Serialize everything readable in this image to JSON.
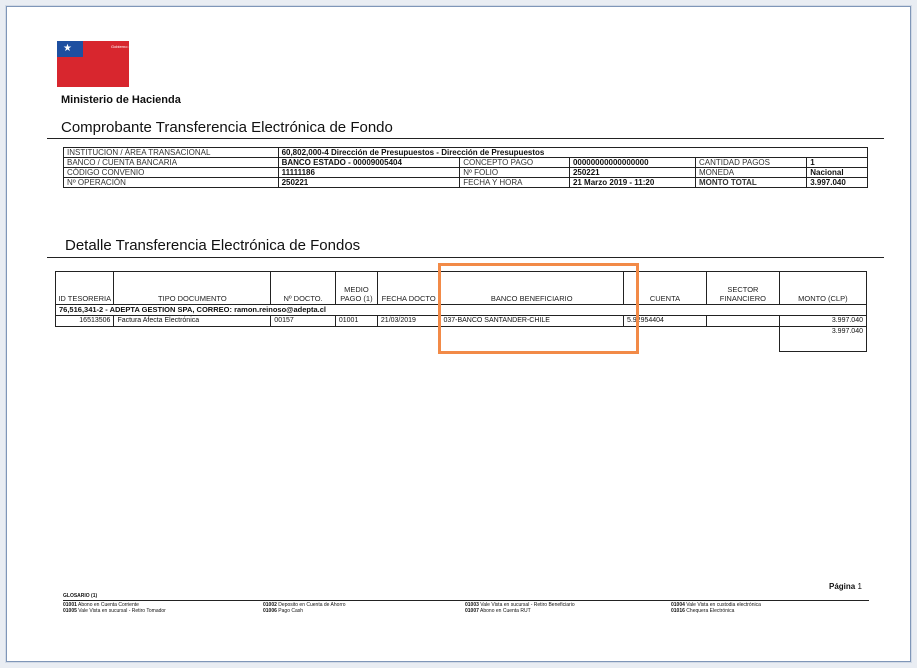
{
  "header": {
    "ministry": "Ministerio de Hacienda",
    "logo_text": "Gobierno de Chile",
    "title": "Comprobante Transferencia Electrónica de Fondo"
  },
  "info": {
    "institucion_label": "INSTITUCION / ÁREA TRANSACIONAL",
    "institucion_value": "60,802,000-4 Dirección de Presupuestos - Dirección de Presupuestos",
    "banco_label": "BANCO / CUENTA BANCARIA",
    "banco_value": "BANCO ESTADO - 00009005404",
    "concepto_label": "CONCEPTO PAGO",
    "concepto_value": "00000000000000000",
    "cantidad_label": "CANTIDAD PAGOS",
    "cantidad_value": "1",
    "codigo_label": "CÓDIGO CONVENIO",
    "codigo_value": "11111186",
    "folio_label": "Nº FOLIO",
    "folio_value": "250221",
    "moneda_label": "MONEDA",
    "moneda_value": "Nacional",
    "operacion_label": "Nº OPERACIÓN",
    "operacion_value": "250221",
    "fecha_label": "FECHA Y HORA",
    "fecha_value": "21 Marzo 2019 - 11:20",
    "monto_label": "MONTO TOTAL",
    "monto_value": "3.997.040"
  },
  "detail": {
    "title": "Detalle Transferencia Electrónica de Fondos",
    "headers": [
      "ID TESORERIA",
      "TIPO DOCUMENTO",
      "Nº DOCTO.",
      "MEDIO PAGO (1)",
      "FECHA DOCTO",
      "BANCO BENEFICIARIO",
      "CUENTA",
      "SECTOR FINANCIERO",
      "MONTO (CLP)"
    ],
    "group_label": "76,516,341-2 - ADEPTA GESTION SPA, CORREO:",
    "group_email": "ramon.reinoso@adepta.cl",
    "row": {
      "id": "16513506",
      "tipo": "Factura Afecta Electrónica",
      "docto": "00157",
      "medio": "01001",
      "fecha": "21/03/2019",
      "banco": "037-BANCO SANTANDER-CHILE",
      "cuenta": "5.92954404",
      "sector": "",
      "monto": "3.997.040"
    },
    "total": "3.997.040"
  },
  "footer": {
    "page_label": "Página",
    "page_number": "1",
    "glossary_title": "GLOSARIO (1)",
    "glossary": [
      {
        "code": "01001",
        "text": "Abono en Cuenta Corriente"
      },
      {
        "code": "01005",
        "text": "Vale Vista en sucursal - Retiro Tomador"
      },
      {
        "code": "01002",
        "text": "Deposito en Cuenta de Ahorro"
      },
      {
        "code": "01006",
        "text": "Pago Cash"
      },
      {
        "code": "01003",
        "text": "Vale Vista en sucursal - Retiro Beneficiario"
      },
      {
        "code": "01007",
        "text": "Abono en Cuenta RUT"
      },
      {
        "code": "01004",
        "text": "Vale Vista en custodia electrónica"
      },
      {
        "code": "01016",
        "text": "Chequera Electrónica"
      }
    ]
  }
}
